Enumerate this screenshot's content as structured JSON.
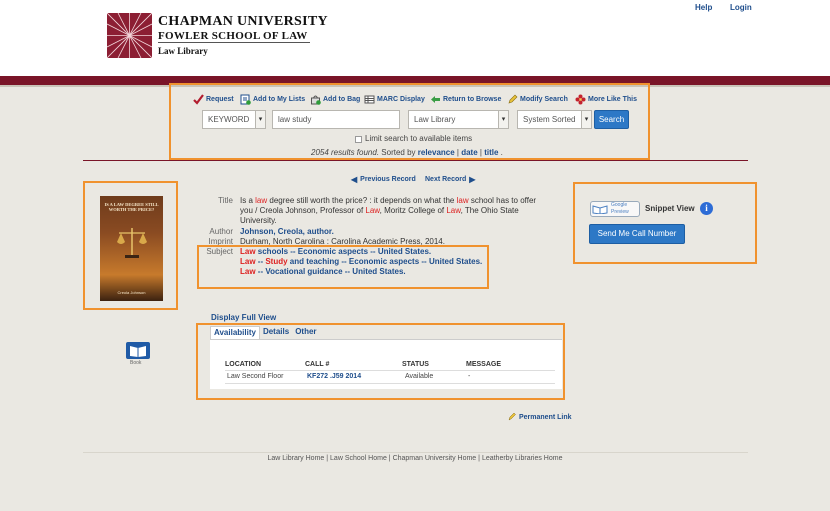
{
  "header": {
    "university": "CHAPMAN UNIVERSITY",
    "school": "FOWLER SCHOOL OF LAW",
    "library": "Law Library",
    "help": "Help",
    "login": "Login"
  },
  "toolbar": {
    "request": "Request",
    "add_to_lists": "Add to My Lists",
    "add_to_bag": "Add to Bag",
    "marc_display": "MARC Display",
    "return_to_browse": "Return to Browse",
    "modify_search": "Modify Search",
    "more_like_this": "More Like This"
  },
  "search": {
    "field_type": "KEYWORD",
    "query": "law study",
    "scope": "Law Library",
    "sort": "System Sorted",
    "search_button": "Search",
    "limit_label": "Limit search to available items",
    "results_count_text": "2054 results found.",
    "sorted_by_text": "Sorted by",
    "sort_relevance": "relevance",
    "sort_date": "date",
    "sort_title": "title"
  },
  "record_nav": {
    "previous": "Previous Record",
    "next": "Next Record"
  },
  "cover": {
    "title": "IS A LAW DEGREE STILL WORTH THE PRICE?",
    "author": "Creola Johnson"
  },
  "record": {
    "labels": {
      "title": "Title",
      "author": "Author",
      "imprint": "Imprint",
      "subject": "Subject"
    },
    "title_parts": [
      "Is a ",
      "law",
      " degree still worth the price? : it depends on what the ",
      "law",
      " school has to offer"
    ],
    "title_line2_parts": [
      "you / Creola Johnson, Professor of ",
      "Law",
      ", Moritz College of ",
      "Law",
      ", The Ohio State"
    ],
    "title_line3": "University.",
    "author": "Johnson, Creola, author.",
    "imprint": "Durham, North Carolina : Carolina Academic Press, 2014.",
    "subjects": [
      [
        "Law",
        " schools -- Economic aspects -- United States."
      ],
      [
        "Law",
        " -- ",
        "Study",
        " and teaching -- Economic aspects -- United States."
      ],
      [
        "Law",
        " -- Vocational guidance -- United States."
      ]
    ]
  },
  "sidebar": {
    "google_preview": "Google Preview",
    "snippet_view": "Snippet View",
    "send_call_number": "Send Me Call Number"
  },
  "holdings": {
    "display_full_view": "Display Full View",
    "tabs": [
      "Availability",
      "Details",
      "Other"
    ],
    "columns": [
      "LOCATION",
      "CALL #",
      "STATUS",
      "MESSAGE"
    ],
    "row": {
      "location": "Law Second Floor",
      "call": "KF272 .J59 2014",
      "status": "Available",
      "message": "-"
    }
  },
  "format": {
    "label": "Book"
  },
  "permanent_link": "Permanent Link",
  "footer": {
    "links": [
      "Law Library Home",
      "Law School Home",
      "Chapman University Home",
      "Leatherby Libraries Home"
    ],
    "separator": " | "
  }
}
